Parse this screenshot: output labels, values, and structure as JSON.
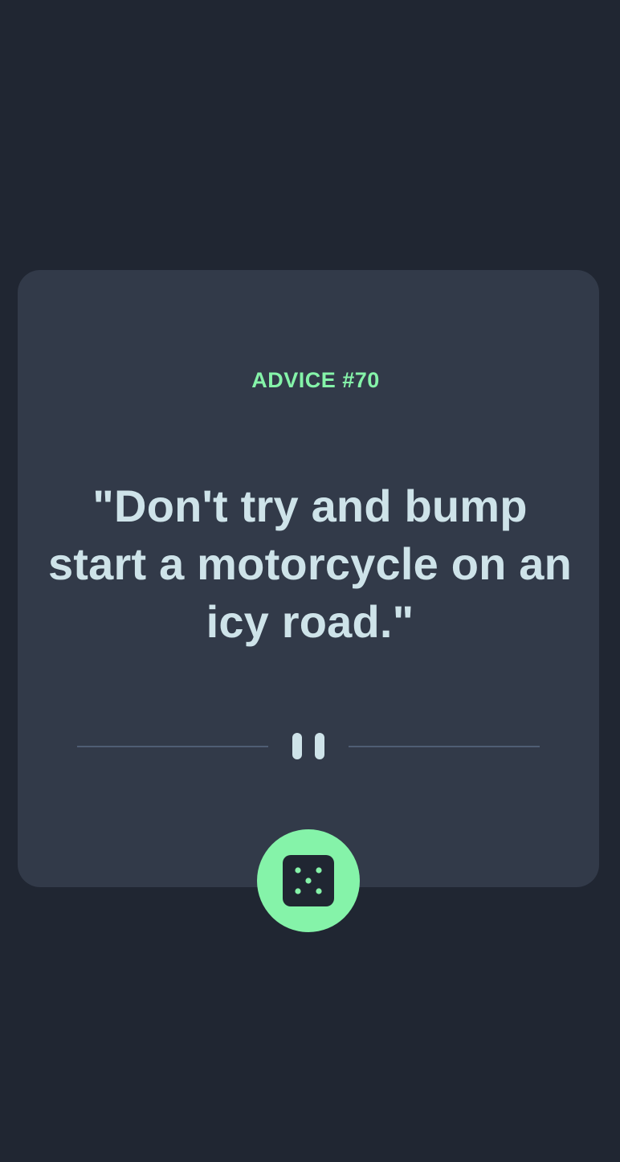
{
  "advice": {
    "label": "ADVICE #70",
    "quote": "\"Don't try and bump start a motorcycle on an icy road.\""
  },
  "divider": {
    "icon": "pause-icon"
  },
  "dice_button": {
    "icon": "dice-icon"
  },
  "colors": {
    "background": "#202632",
    "card": "#323a49",
    "accent": "#85f3a9",
    "text": "#cee3e9",
    "divider": "#4f5d74"
  }
}
